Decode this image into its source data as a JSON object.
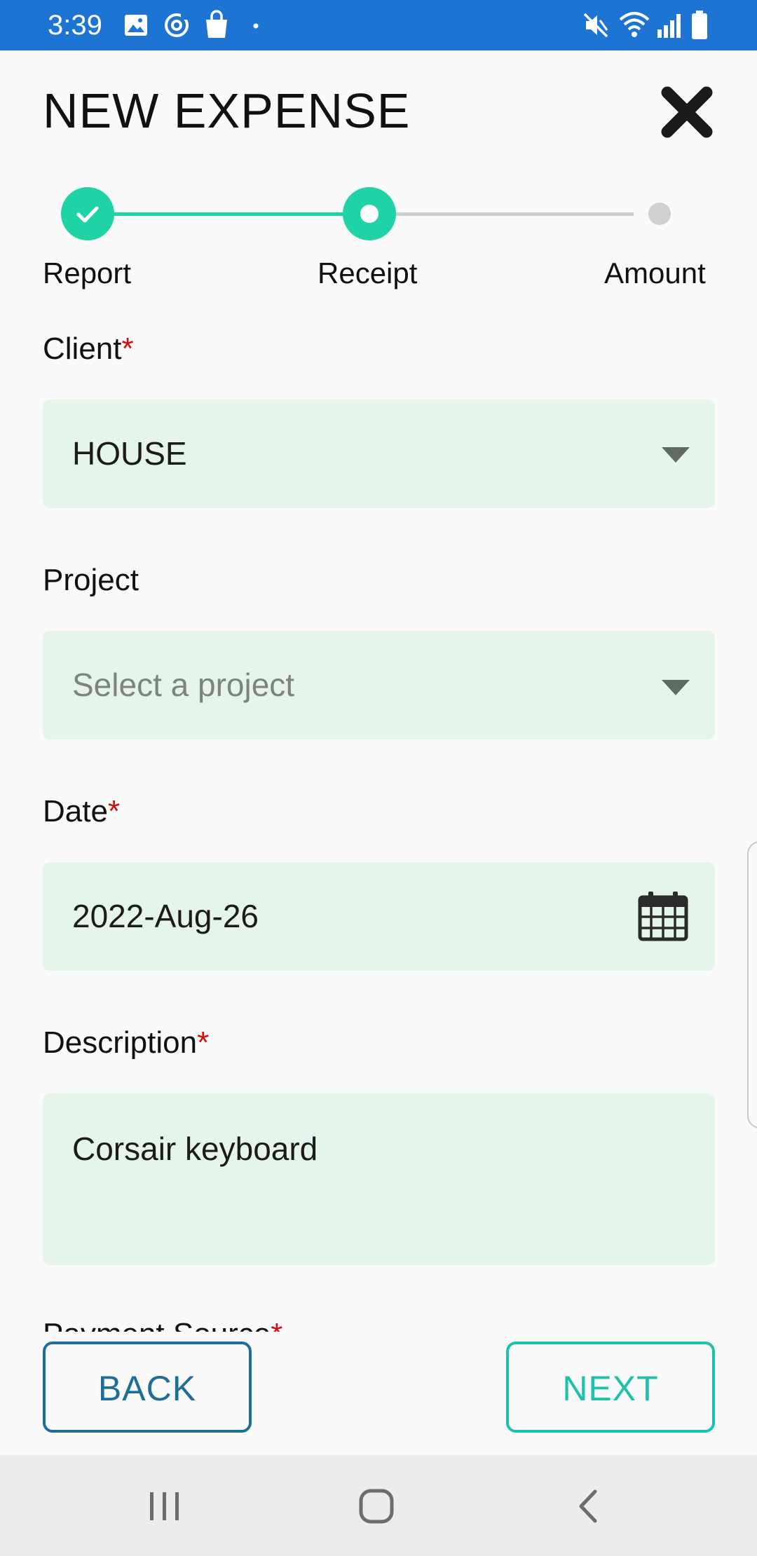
{
  "status_bar": {
    "time": "3:39",
    "color": "#1d74d3",
    "icons_left": [
      "image-icon",
      "sync-icon",
      "shopping-bag-icon",
      "dot-icon"
    ],
    "icons_right": [
      "mute-icon",
      "wifi-icon",
      "signal-icon",
      "battery-icon"
    ]
  },
  "header": {
    "title": "NEW EXPENSE",
    "close_icon": "close-icon"
  },
  "stepper": {
    "active_color": "#1fd3a7",
    "steps": [
      {
        "label": "Report",
        "state": "completed"
      },
      {
        "label": "Receipt",
        "state": "current"
      },
      {
        "label": "Amount",
        "state": "upcoming"
      }
    ]
  },
  "form": {
    "required_mark": "*",
    "client": {
      "label": "Client",
      "value": "HOUSE",
      "required": true
    },
    "project": {
      "label": "Project",
      "placeholder": "Select a project",
      "required": false
    },
    "date": {
      "label": "Date",
      "value": "2022-Aug-26",
      "required": true,
      "icon": "calendar-icon"
    },
    "description": {
      "label": "Description",
      "value": "Corsair keyboard",
      "required": true
    },
    "next_field_partial_label": "Payment Source"
  },
  "buttons": {
    "back": "BACK",
    "next": "NEXT"
  },
  "nav_bar": {
    "items": [
      "recent-apps-icon",
      "home-icon",
      "back-icon"
    ]
  }
}
